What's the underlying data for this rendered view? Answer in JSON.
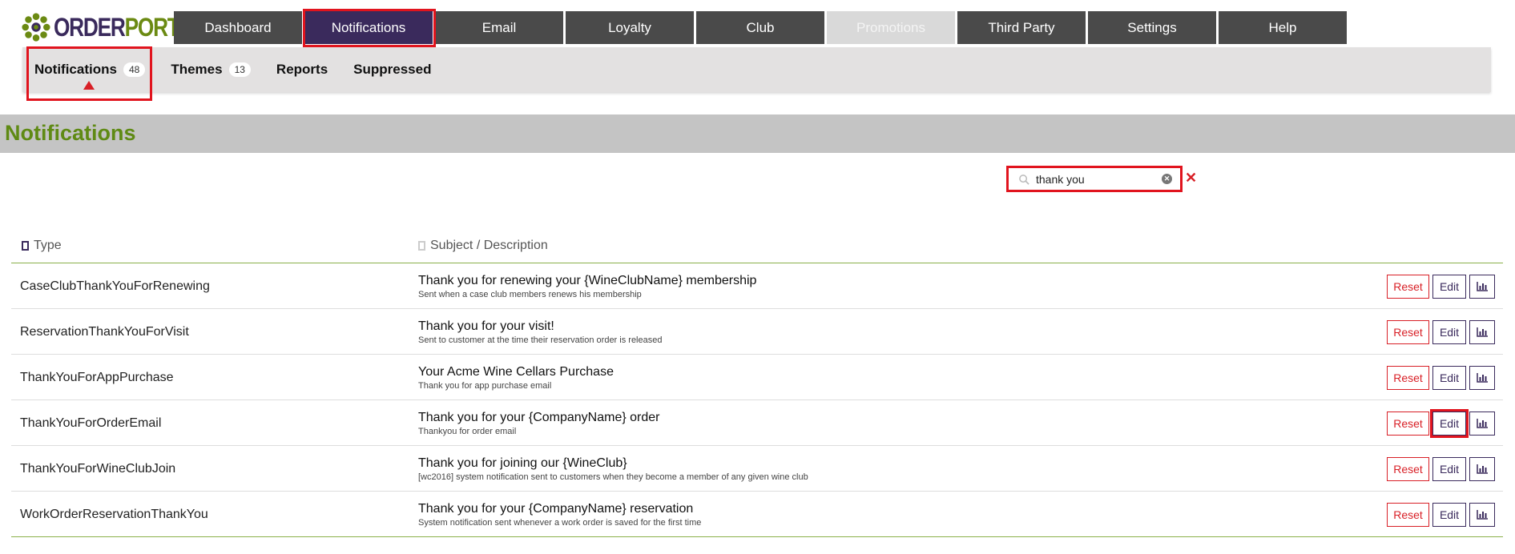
{
  "logo": {
    "text_part1": "ORDER",
    "text_part2": "PORT"
  },
  "nav": {
    "tabs": [
      {
        "label": "Dashboard",
        "state": "normal"
      },
      {
        "label": "Notifications",
        "state": "active"
      },
      {
        "label": "Email",
        "state": "normal"
      },
      {
        "label": "Loyalty",
        "state": "normal"
      },
      {
        "label": "Club",
        "state": "normal"
      },
      {
        "label": "Promotions",
        "state": "disabled"
      },
      {
        "label": "Third Party",
        "state": "normal"
      },
      {
        "label": "Settings",
        "state": "normal"
      },
      {
        "label": "Help",
        "state": "normal"
      }
    ]
  },
  "subnav": {
    "items": [
      {
        "label": "Notifications",
        "count": "48"
      },
      {
        "label": "Themes",
        "count": "13"
      },
      {
        "label": "Reports",
        "count": ""
      },
      {
        "label": "Suppressed",
        "count": ""
      }
    ]
  },
  "page": {
    "title": "Notifications"
  },
  "search": {
    "value": "thank you",
    "clear_icon": "clear-circle-icon",
    "reset_symbol": "✕"
  },
  "table": {
    "headers": {
      "type": "Type",
      "subject": "Subject / Description"
    },
    "rows": [
      {
        "type": "CaseClubThankYouForRenewing",
        "subject": "Thank you for renewing your {WineClubName} membership",
        "description": "Sent when a case club members renews his membership"
      },
      {
        "type": "ReservationThankYouForVisit",
        "subject": "Thank you for your visit!",
        "description": "Sent to customer at the time their reservation order is released"
      },
      {
        "type": "ThankYouForAppPurchase",
        "subject": "Your Acme Wine Cellars Purchase",
        "description": "Thank you for app purchase email"
      },
      {
        "type": "ThankYouForOrderEmail",
        "subject": "Thank you for your {CompanyName} order",
        "description": "Thankyou for order email"
      },
      {
        "type": "ThankYouForWineClubJoin",
        "subject": "Thank you for joining our {WineClub}",
        "description": "[wc2016] system notification sent to customers when they become a member of any given wine club"
      },
      {
        "type": "WorkOrderReservationThankYou",
        "subject": "Thank you for your {CompanyName} reservation",
        "description": "System notification sent whenever a work order is saved for the first time"
      }
    ],
    "actions": {
      "reset_label": "Reset",
      "edit_label": "Edit",
      "stats_icon": "bar-chart-icon"
    }
  },
  "colors": {
    "brand_purple": "#3a2a5c",
    "brand_green": "#5f8a14",
    "highlight_red": "#e1141e"
  }
}
